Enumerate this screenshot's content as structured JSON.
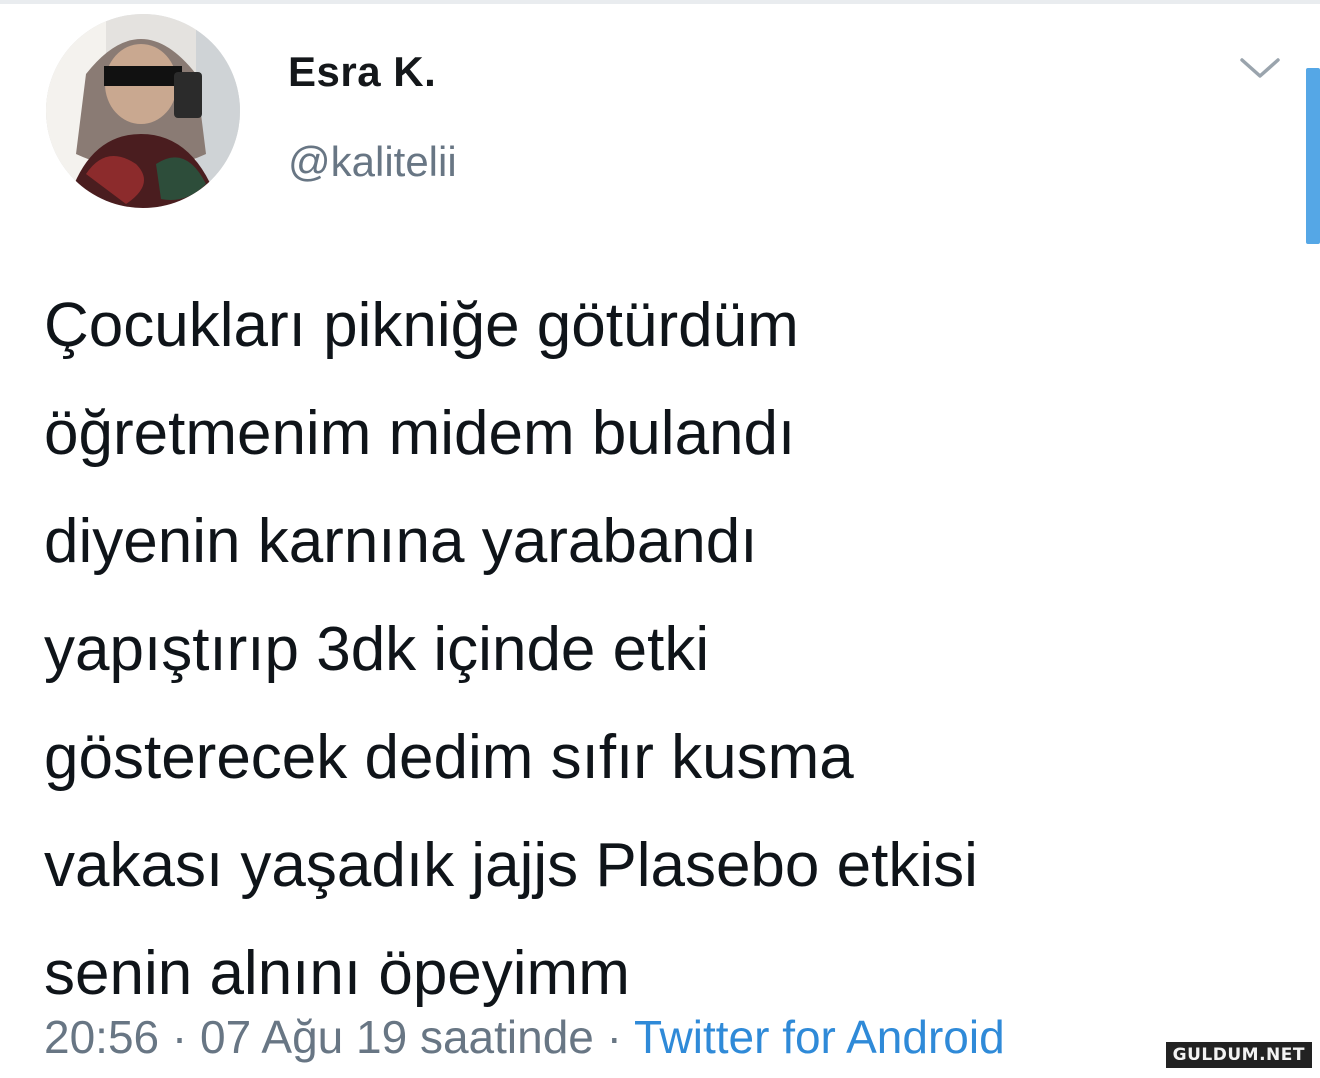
{
  "tweet": {
    "author": {
      "display_name": "Esra K.",
      "handle": "@kalitelii"
    },
    "text": "Çocukları pikniğe götürdüm\nöğretmenim midem bulandı\ndiyenin karnına yarabandı\nyapıştırıp 3dk içinde etki\ngösterecek dedim sıfır kusma\nvakası yaşadık jajjs Plasebo etkisi\nsenin alnını öpeyimm",
    "timestamp": "20:56 · 07 Ağu 19 saatinde",
    "separator": " · ",
    "source": "Twitter for Android",
    "menu_icon": "chevron-down-icon"
  },
  "watermark": "GULDUM.NET",
  "colors": {
    "link": "#2f8ad8",
    "secondary_text": "#687684",
    "scrollbar": "#55a7e6"
  }
}
